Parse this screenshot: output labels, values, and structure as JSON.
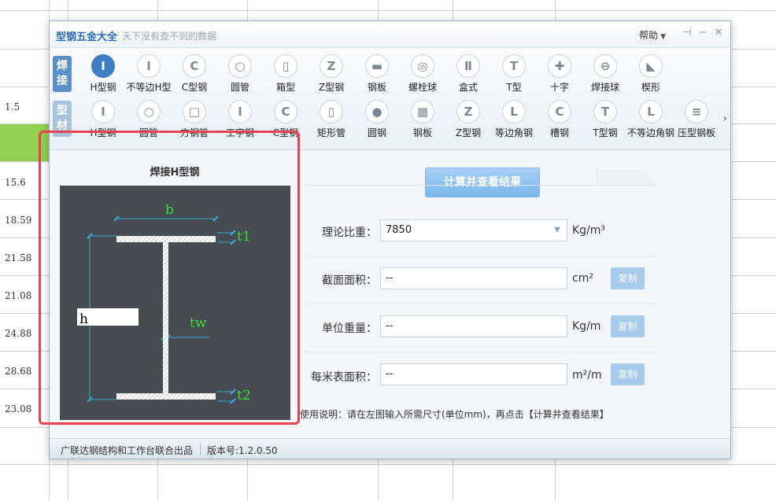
{
  "sheet": {
    "row_values": [
      "1.5",
      "15.6",
      "18.59",
      "21.58",
      "21.08",
      "24.88",
      "28.68",
      "23.08"
    ]
  },
  "window": {
    "title": "型钢五金大全",
    "subtitle": "天下没有查不到的数据",
    "help_label": "帮助"
  },
  "categories": [
    {
      "label": "焊接",
      "active": true
    },
    {
      "label": "型材",
      "active": false
    }
  ],
  "toolbar_row1": [
    {
      "label": "H型钢",
      "icon": "i-beam-icon",
      "glyph": "I",
      "selected": true
    },
    {
      "label": "不等边H型",
      "icon": "unequal-h-icon",
      "glyph": "I",
      "selected": false
    },
    {
      "label": "C型钢",
      "icon": "c-channel-icon",
      "glyph": "C",
      "selected": false
    },
    {
      "label": "圆管",
      "icon": "round-tube-icon",
      "glyph": "○",
      "selected": false
    },
    {
      "label": "箱型",
      "icon": "box-section-icon",
      "glyph": "▯",
      "selected": false
    },
    {
      "label": "Z型钢",
      "icon": "z-section-icon",
      "glyph": "Z",
      "selected": false
    },
    {
      "label": "钢板",
      "icon": "steel-plate-icon",
      "glyph": "▬",
      "selected": false
    },
    {
      "label": "螺栓球",
      "icon": "bolt-ball-icon",
      "glyph": "◎",
      "selected": false
    },
    {
      "label": "盒式",
      "icon": "box-type-icon",
      "glyph": "Ⅱ",
      "selected": false
    },
    {
      "label": "T型",
      "icon": "t-section-icon",
      "glyph": "T",
      "selected": false
    },
    {
      "label": "十字",
      "icon": "cross-section-icon",
      "glyph": "✚",
      "selected": false
    },
    {
      "label": "焊接球",
      "icon": "welded-ball-icon",
      "glyph": "⊖",
      "selected": false
    },
    {
      "label": "楔形",
      "icon": "wedge-icon",
      "glyph": "◣",
      "selected": false
    }
  ],
  "toolbar_row2": [
    {
      "label": "H型钢",
      "icon": "i-beam-icon",
      "glyph": "I"
    },
    {
      "label": "圆管",
      "icon": "round-tube-icon",
      "glyph": "○"
    },
    {
      "label": "方钢管",
      "icon": "square-tube-icon",
      "glyph": "□"
    },
    {
      "label": "工字钢",
      "icon": "i-steel-icon",
      "glyph": "I"
    },
    {
      "label": "C型钢",
      "icon": "c-channel-icon",
      "glyph": "C"
    },
    {
      "label": "矩形管",
      "icon": "rect-tube-icon",
      "glyph": "▯"
    },
    {
      "label": "圆钢",
      "icon": "round-bar-icon",
      "glyph": "●"
    },
    {
      "label": "钢板",
      "icon": "checker-plate-icon",
      "glyph": "▦"
    },
    {
      "label": "Z型钢",
      "icon": "z-section-icon",
      "glyph": "Z"
    },
    {
      "label": "等边角钢",
      "icon": "equal-angle-icon",
      "glyph": "L"
    },
    {
      "label": "槽钢",
      "icon": "channel-icon",
      "glyph": "C"
    },
    {
      "label": "T型钢",
      "icon": "t-steel-icon",
      "glyph": "T"
    },
    {
      "label": "不等边角钢",
      "icon": "unequal-angle-icon",
      "glyph": "L"
    },
    {
      "label": "压型钢板",
      "icon": "profiled-plate-icon",
      "glyph": "≡"
    }
  ],
  "drawing": {
    "title": "焊接H型钢",
    "dim_b": "b",
    "dim_h": "h",
    "dim_t1": "t1",
    "dim_t2": "t2",
    "dim_tw": "tw"
  },
  "form": {
    "calc_button": "计算并查看结果",
    "density_label": "理论比重：",
    "density_value": "7850",
    "density_unit": "Kg/m³",
    "area_label": "截面面积：",
    "area_value": "--",
    "area_unit": "cm²",
    "weight_label": "单位重量：",
    "weight_value": "--",
    "weight_unit": "Kg/m",
    "surface_label": "每米表面积：",
    "surface_value": "--",
    "surface_unit": "m²/m",
    "copy_label": "复制",
    "usage": "使用说明：请在左图输入所需尺寸(单位mm)，再点击【计算并查看结果】"
  },
  "status": {
    "publisher": "广联达钢结构和工作台联合出品",
    "version": "版本号:1.2.0.50"
  }
}
